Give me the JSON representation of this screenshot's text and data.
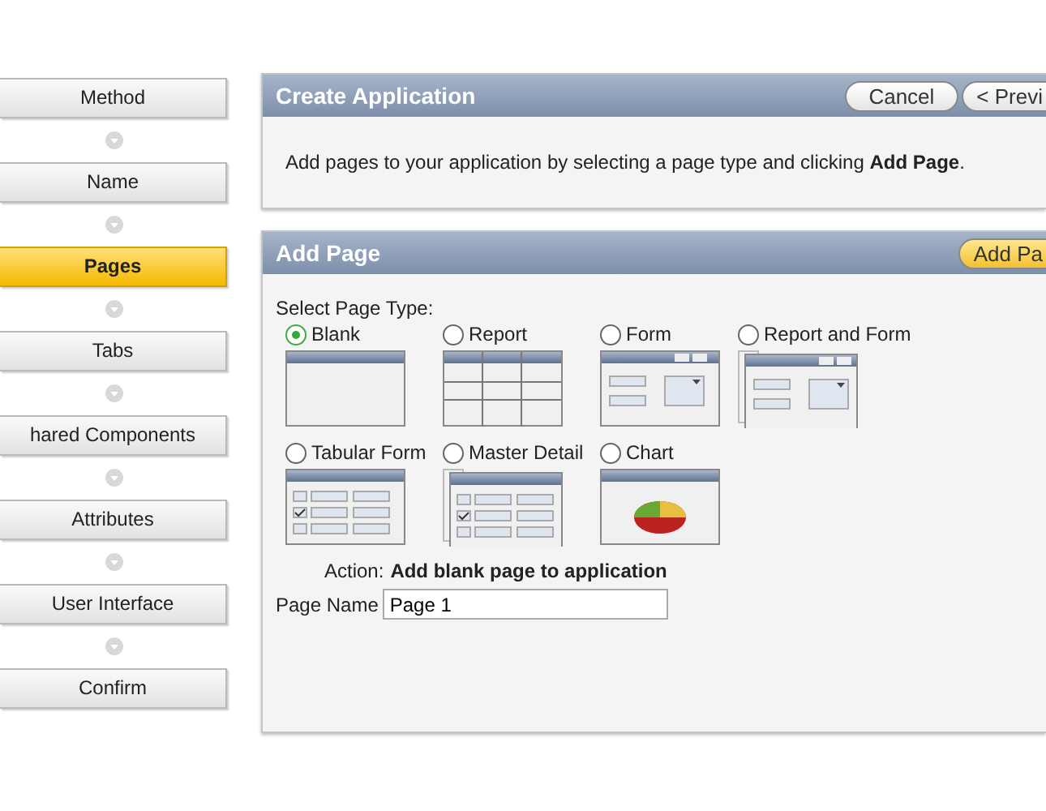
{
  "wizard_steps": [
    {
      "label": "Method",
      "selected": false
    },
    {
      "label": "Name",
      "selected": false
    },
    {
      "label": "Pages",
      "selected": true
    },
    {
      "label": "Tabs",
      "selected": false
    },
    {
      "label": "hared Components",
      "selected": false
    },
    {
      "label": "Attributes",
      "selected": false
    },
    {
      "label": "User Interface",
      "selected": false
    },
    {
      "label": "Confirm",
      "selected": false
    }
  ],
  "create_panel": {
    "title": "Create Application",
    "buttons": [
      {
        "label": "Cancel"
      },
      {
        "label": "< Previ"
      }
    ],
    "instruction": "Add pages to your application by selecting a page type and clicking **Add Page**."
  },
  "add_panel": {
    "title": "Add Page",
    "button": "Add Pa",
    "select_label": "Select Page Type:",
    "page_types": [
      {
        "label": "Blank",
        "kind": "blank",
        "selected": true
      },
      {
        "label": "Report",
        "kind": "report",
        "selected": false
      },
      {
        "label": "Form",
        "kind": "form",
        "selected": false
      },
      {
        "label": "Report and Form",
        "kind": "report-form",
        "selected": false
      },
      {
        "label": "Tabular Form",
        "kind": "tabular",
        "selected": false
      },
      {
        "label": "Master Detail",
        "kind": "master-detail",
        "selected": false
      },
      {
        "label": "Chart",
        "kind": "chart",
        "selected": false
      }
    ],
    "action_label": "Action:",
    "action_value": "Add blank page to application",
    "page_name_label": "Page Name",
    "page_name_value": "Page 1"
  }
}
